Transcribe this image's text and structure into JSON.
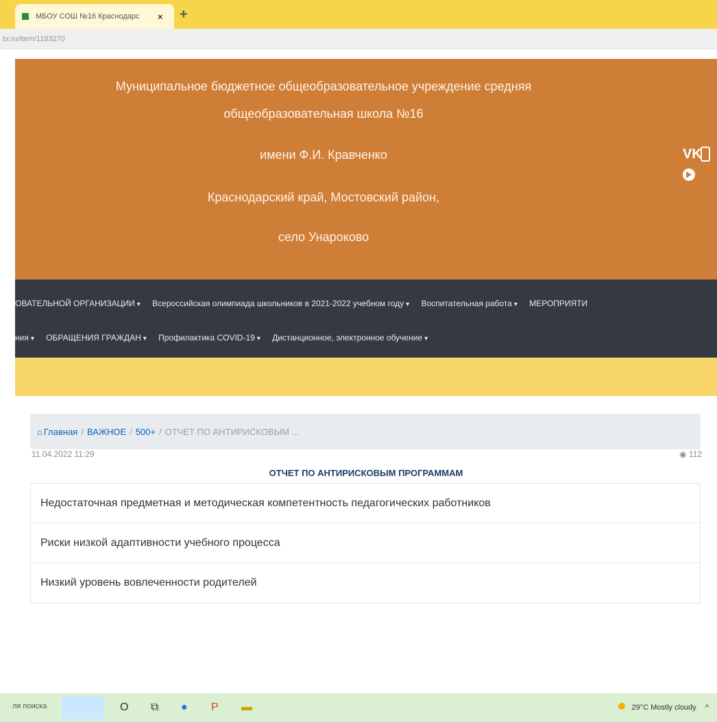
{
  "browser": {
    "tab_title": "МБОУ СОШ №16 Краснодарс",
    "tab_close": "×",
    "new_tab": "+",
    "url": "br.ru/item/1183270"
  },
  "header": {
    "lines": [
      "Муниципальное бюджетное общеобразовательное учреждение средняя",
      "общеобразовательная школа №16",
      "имени Ф.И. Кравченко",
      "Краснодарский край, Мостовский район,",
      "село Унароково"
    ],
    "social": {
      "vk": "VK"
    }
  },
  "nav": {
    "row1": [
      "ОВАТЕЛЬНОЙ ОРГАНИЗАЦИИ",
      "Всероссийская олимпиада школьников в 2021-2022 учебном году",
      "Воспитательная работа",
      "МЕРОПРИЯТИ"
    ],
    "row2": [
      "ния",
      "ОБРАЩЕНИЯ ГРАЖДАН",
      "Профилактика COVID-19",
      "Дистанционное, электронное обучение"
    ],
    "caret": "▾"
  },
  "breadcrumb": {
    "home_icon": "⌂",
    "home": "Главная",
    "sep": "/",
    "c1": "ВАЖНОЕ",
    "c2": "500+",
    "current": "ОТЧЕТ ПО АНТИРИСКОВЫМ ..."
  },
  "article": {
    "date": "11.04.2022 11:29",
    "views_icon": "◉",
    "views": "112",
    "title": "ОТЧЕТ ПО АНТИРИСКОВЫМ ПРОГРАММАМ",
    "items": [
      "Недостаточная предметная и методическая компетентность педагогических работников",
      "Риски низкой адаптивности учебного процесса",
      "Низкий уровень вовлеченности родителей"
    ]
  },
  "taskbar": {
    "search_text": "ля поиска",
    "weather": "29°C  Mostly cloudy",
    "icons": {
      "cortana": "O",
      "taskview": "⧉",
      "chrome": "●",
      "ppt": "P",
      "explorer": "▬"
    },
    "chevron": "^"
  }
}
